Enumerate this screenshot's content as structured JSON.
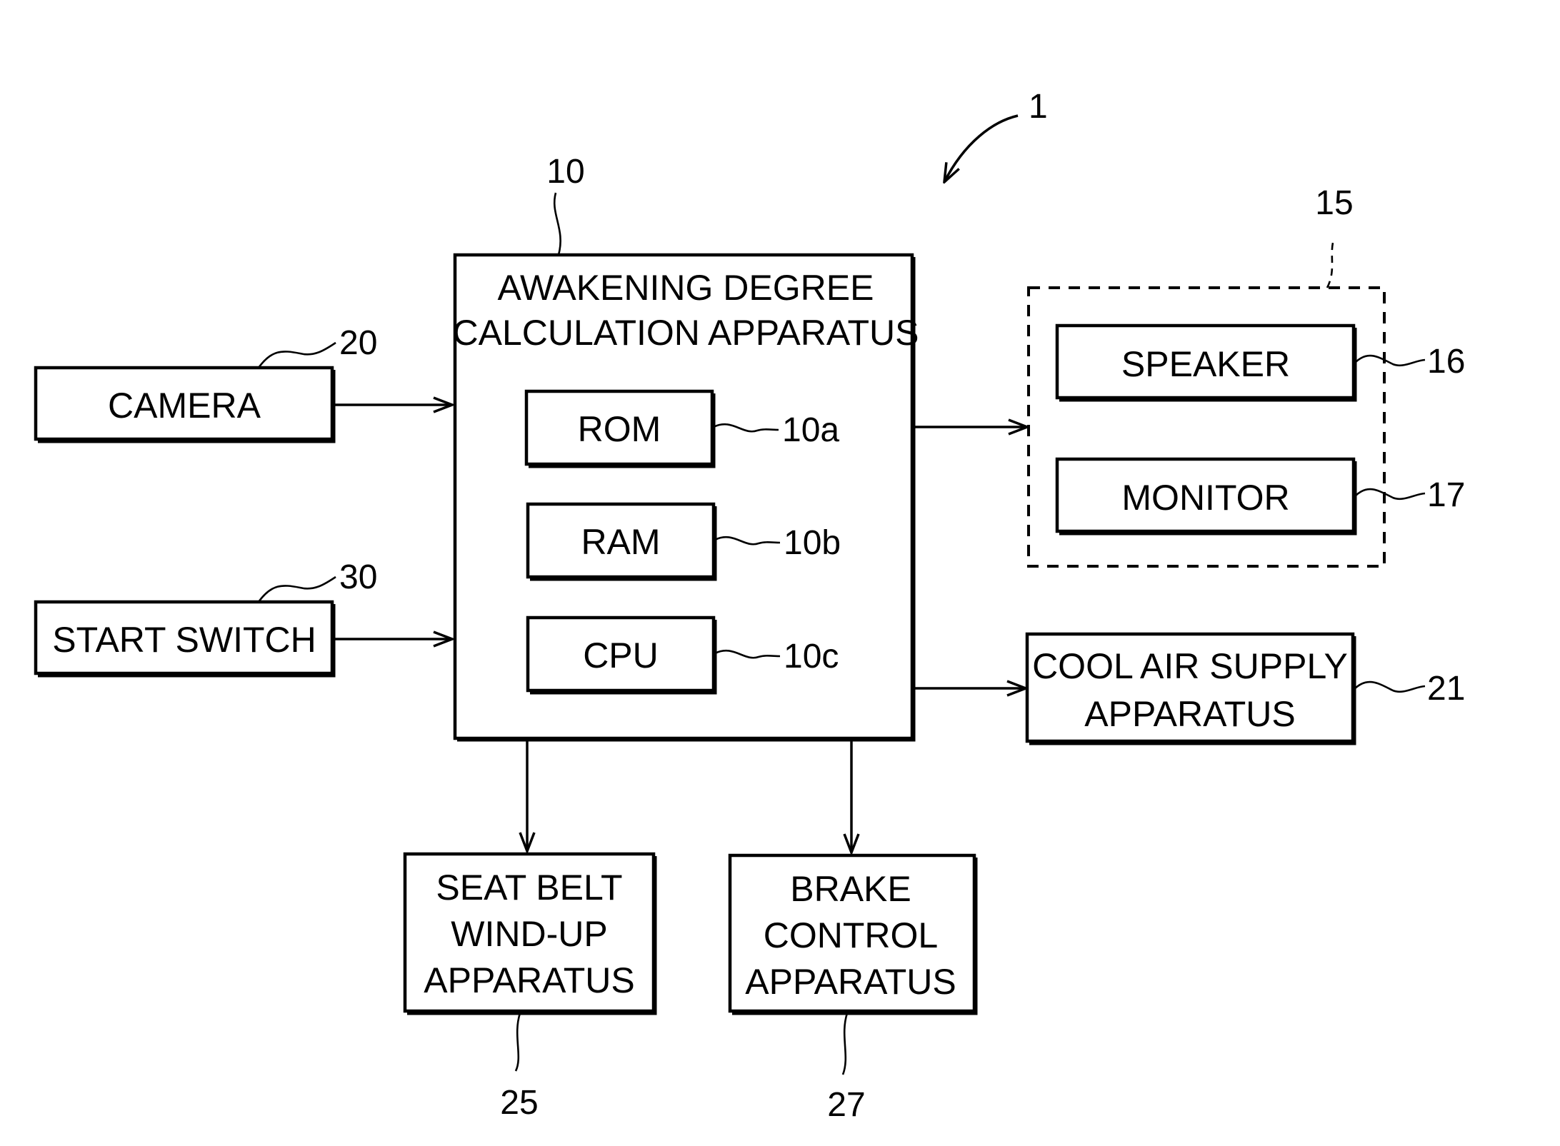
{
  "figure": {
    "system_ref": "1",
    "main_unit": {
      "ref": "10",
      "title_lines": [
        "AWAKENING DEGREE",
        "CALCULATION APPARATUS"
      ],
      "components": [
        {
          "label": "ROM",
          "ref": "10a"
        },
        {
          "label": "RAM",
          "ref": "10b"
        },
        {
          "label": "CPU",
          "ref": "10c"
        }
      ]
    },
    "inputs": [
      {
        "label": "CAMERA",
        "ref": "20"
      },
      {
        "label": "START SWITCH",
        "ref": "30"
      }
    ],
    "notification_group": {
      "ref": "15",
      "items": [
        {
          "label": "SPEAKER",
          "ref": "16"
        },
        {
          "label": "MONITOR",
          "ref": "17"
        }
      ]
    },
    "cool_air": {
      "lines": [
        "COOL AIR SUPPLY",
        "APPARATUS"
      ],
      "ref": "21"
    },
    "seat_belt": {
      "lines": [
        "SEAT BELT",
        "WIND-UP",
        "APPARATUS"
      ],
      "ref": "25"
    },
    "brake": {
      "lines": [
        "BRAKE",
        "CONTROL",
        "APPARATUS"
      ],
      "ref": "27"
    }
  }
}
